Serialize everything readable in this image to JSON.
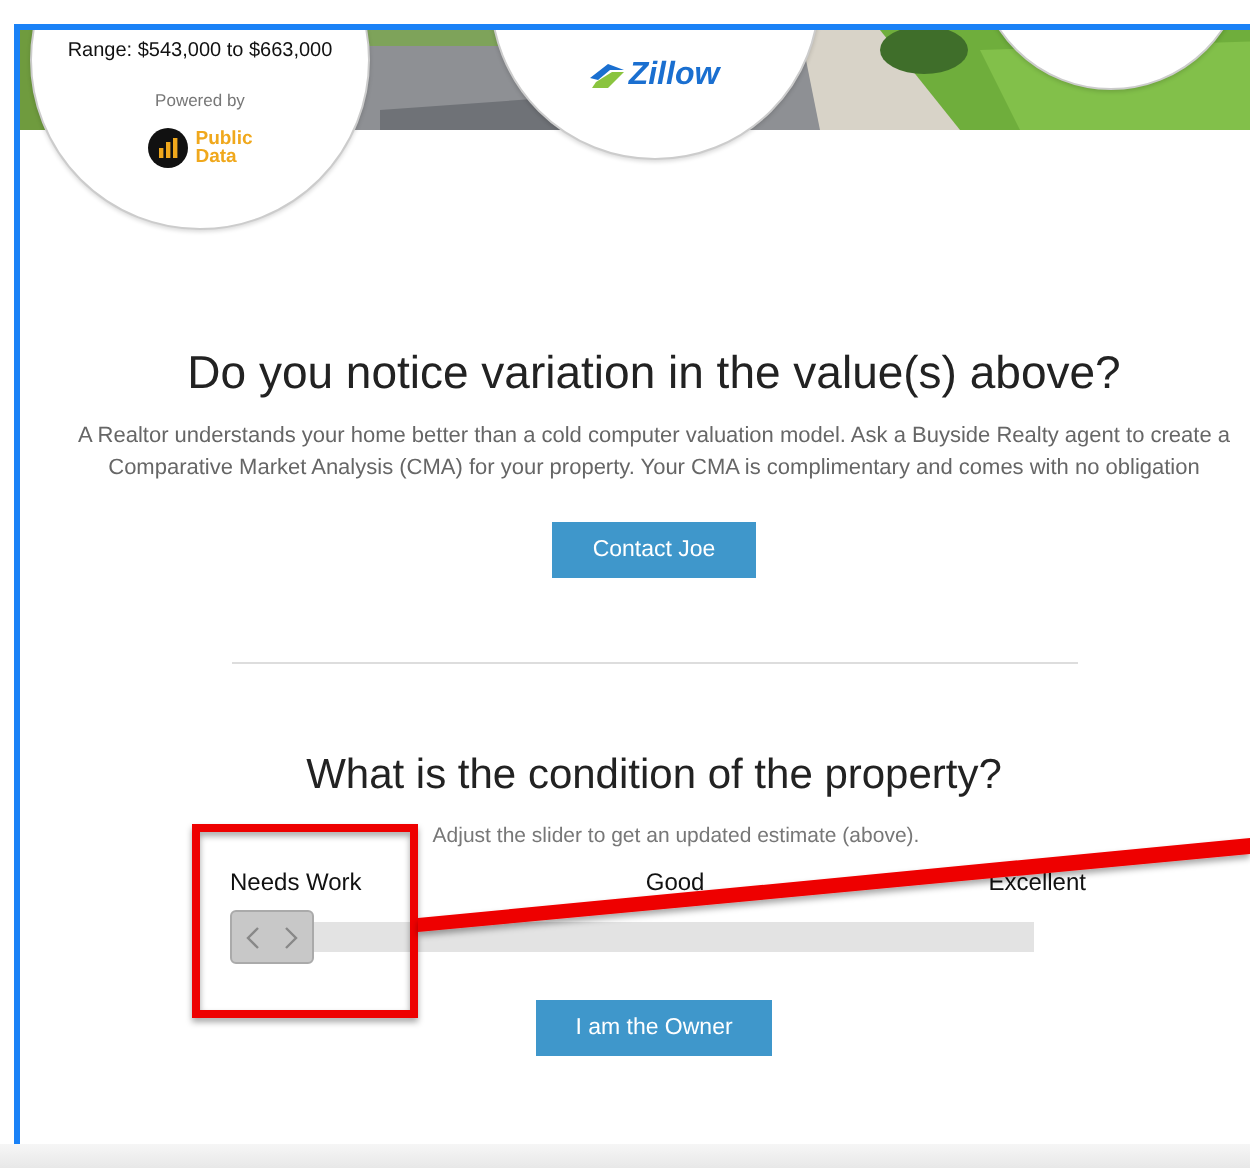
{
  "estimate_cards": [
    {
      "kind": "public_data",
      "range": "Range: $543,000 to $663,000",
      "powered_by": "Powered by",
      "logo_lines": [
        "Public",
        "Data"
      ]
    },
    {
      "kind": "zillow",
      "logo_text": "Zillow"
    },
    {
      "kind": "blank"
    }
  ],
  "variation": {
    "title": "Do you notice variation in the value(s) above?",
    "text": "A Realtor understands your home better than a cold computer valuation model. Ask a Buyside Realty agent to create a Comparative Market Analysis (CMA) for your property. Your CMA is complimentary and comes with no obligation",
    "button": "Contact Joe"
  },
  "condition": {
    "title": "What is the condition of the property?",
    "hint": "Adjust the slider to get an updated estimate (above).",
    "labels": [
      "Needs Work",
      "Good",
      "Excellent"
    ],
    "level": 0,
    "button": "I am the Owner"
  }
}
